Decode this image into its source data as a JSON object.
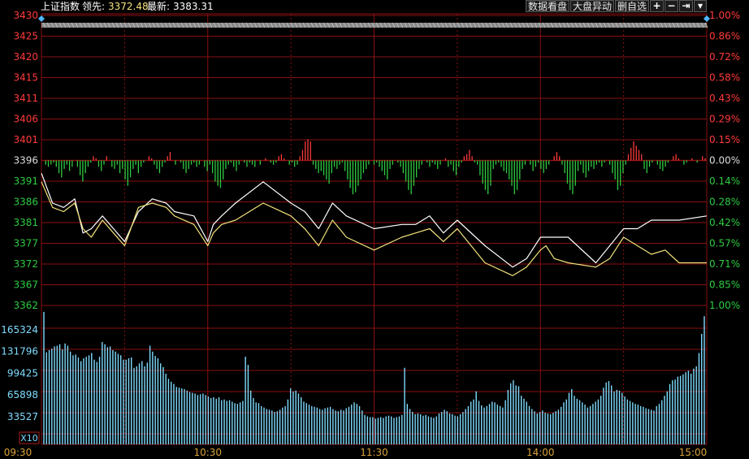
{
  "header": {
    "index_name": "上证指数",
    "leader_label": "领先:",
    "leader_value": "3372.48",
    "latest_label": "最新:",
    "latest_value": "3383.31"
  },
  "toolbar": {
    "data_view_label": "数据看盘",
    "market_move_label": "大盘异动",
    "delete_watchlist_label": "删自选",
    "buttons": [
      {
        "name": "zoom-in-button",
        "icon": "plus-icon",
        "glyph": "+"
      },
      {
        "name": "zoom-out-button",
        "icon": "minus-icon",
        "glyph": "−"
      },
      {
        "name": "pin-right-button",
        "icon": "arrow-bar-right-icon",
        "glyph": "⇥"
      },
      {
        "name": "dropdown-button",
        "icon": "triangle-down-icon",
        "glyph": "▾"
      }
    ]
  },
  "colors": {
    "background": "#000000",
    "grid": "#8a1010",
    "up": "#ff3a3a",
    "down": "#2ecc40",
    "white_line": "#ffffff",
    "yellow_line": "#f2e27a",
    "volume": "#7fdcff",
    "time_labels": "#d8a23a",
    "header_value": "#f2e27a"
  },
  "chart_data": {
    "type": "line",
    "title": "上证指数",
    "prev_close": 3396,
    "price_ticks": [
      "3430",
      "3425",
      "3420",
      "3415",
      "3411",
      "3406",
      "3401",
      "3396",
      "3391",
      "3386",
      "3381",
      "3377",
      "3372",
      "3367",
      "3362"
    ],
    "pct_ticks": [
      "1.00%",
      "0.86%",
      "0.72%",
      "0.58%",
      "0.43%",
      "0.29%",
      "0.15%",
      "0.00%",
      "0.14%",
      "0.28%",
      "0.42%",
      "0.57%",
      "0.71%",
      "0.85%",
      "1.00%"
    ],
    "ylim": [
      3362,
      3430
    ],
    "x_ticks": [
      "09:30",
      "10:30",
      "11:30",
      "14:00",
      "15:00"
    ],
    "x_tick_minutes": [
      0,
      60,
      120,
      180,
      240
    ],
    "series": [
      {
        "name": "最新",
        "color": "#ffffff",
        "x": [
          0,
          4,
          8,
          12,
          15,
          18,
          22,
          26,
          30,
          35,
          40,
          45,
          48,
          55,
          60,
          62,
          65,
          70,
          80,
          90,
          95,
          100,
          105,
          110,
          120,
          130,
          135,
          140,
          145,
          150,
          160,
          170,
          175,
          180,
          182,
          185,
          190,
          200,
          205,
          210,
          215,
          220,
          225,
          230,
          240
        ],
        "y": [
          3393,
          3386,
          3385,
          3387,
          3379,
          3380,
          3383,
          3380,
          3377,
          3384,
          3387,
          3386,
          3384,
          3383,
          3377,
          3381,
          3383,
          3386,
          3391,
          3386,
          3384,
          3380,
          3386,
          3383,
          3380,
          3381,
          3381,
          3383,
          3379,
          3382,
          3376,
          3371,
          3373,
          3378,
          3378,
          3378,
          3378,
          3372,
          3376,
          3380,
          3380,
          3382,
          3382,
          3382,
          3383
        ]
      },
      {
        "name": "领先",
        "color": "#f2e27a",
        "x": [
          0,
          4,
          8,
          12,
          15,
          18,
          22,
          26,
          30,
          35,
          40,
          45,
          48,
          55,
          60,
          62,
          65,
          70,
          80,
          90,
          95,
          100,
          105,
          110,
          120,
          130,
          135,
          140,
          145,
          150,
          160,
          170,
          175,
          180,
          182,
          185,
          190,
          200,
          205,
          210,
          215,
          220,
          225,
          230,
          240
        ],
        "y": [
          3391,
          3385,
          3384,
          3386,
          3380,
          3378,
          3382,
          3379,
          3376,
          3385,
          3386,
          3385,
          3383,
          3381,
          3376,
          3379,
          3381,
          3382,
          3386,
          3383,
          3380,
          3376,
          3382,
          3378,
          3375,
          3378,
          3379,
          3380,
          3377,
          3380,
          3372,
          3369,
          3371,
          3375,
          3376,
          3373,
          3372,
          3371,
          3373,
          3378,
          3376,
          3374,
          3375,
          3372,
          3372
        ]
      }
    ],
    "diff_bars_scale": "0 = 0.00% line, positive = red (up), negative = green (down), units ≈ 0.01%",
    "diff_bars": [
      0,
      -2,
      -3,
      -2,
      -1,
      -3,
      -6,
      -8,
      -4,
      -2,
      -5,
      -3,
      0,
      -3,
      -7,
      -10,
      -6,
      -3,
      -1,
      2,
      1,
      -3,
      -5,
      -2,
      2,
      0,
      -3,
      -4,
      -2,
      -6,
      -4,
      -9,
      -12,
      -8,
      -4,
      -2,
      -6,
      -3,
      -1,
      0,
      2,
      1,
      -2,
      -4,
      -6,
      -3,
      -1,
      2,
      4,
      0,
      -2,
      0,
      -1,
      -4,
      -6,
      -4,
      -2,
      -1,
      -3,
      -2,
      0,
      -3,
      -5,
      -2,
      -6,
      -10,
      -12,
      -13,
      -9,
      -4,
      -2,
      -1,
      -3,
      -5,
      -2,
      0,
      -1,
      -3,
      -1,
      -2,
      -3,
      0,
      -2,
      0,
      1,
      0,
      -1,
      -2,
      -1,
      2,
      3,
      1,
      0,
      -2,
      -1,
      -3,
      -2,
      2,
      5,
      9,
      10,
      9,
      -2,
      -4,
      -6,
      -5,
      -7,
      -9,
      -11,
      -6,
      -3,
      -4,
      -2,
      -1,
      -5,
      -9,
      -13,
      -16,
      -15,
      -12,
      -9,
      -6,
      -4,
      -2,
      0,
      -2,
      -1,
      -3,
      -5,
      -7,
      -9,
      -4,
      -2,
      0,
      -1,
      -3,
      -6,
      -10,
      -14,
      -16,
      -12,
      -8,
      -4,
      -2,
      0,
      -1,
      -3,
      -1,
      -2,
      -4,
      -2,
      0,
      1,
      -3,
      -2,
      -5,
      -7,
      -3,
      -1,
      2,
      3,
      5,
      2,
      -1,
      -2,
      -7,
      -11,
      -14,
      -16,
      -12,
      -4,
      -2,
      -1,
      -3,
      -5,
      -6,
      -9,
      -12,
      -16,
      -14,
      -9,
      -4,
      -2,
      0,
      -2,
      -5,
      -3,
      -1,
      -4,
      -6,
      -4,
      -2,
      0,
      2,
      4,
      2,
      -2,
      -6,
      -11,
      -14,
      -16,
      -12,
      -5,
      -2,
      -6,
      -8,
      -5,
      -3,
      -4,
      -2,
      -1,
      -3,
      -1,
      0,
      -2,
      -6,
      -9,
      -14,
      -12,
      -6,
      -2,
      3,
      6,
      9,
      7,
      5,
      3,
      -4,
      -6,
      -3,
      -1,
      0,
      -2,
      -4,
      -5,
      -3,
      -1,
      0,
      2,
      3,
      1,
      0,
      -2,
      -1,
      0,
      1,
      0,
      -1,
      0,
      2,
      1
    ],
    "volume": {
      "label_scale": "X10",
      "ticks": [
        "165324",
        "131796",
        "99425",
        "65898",
        "33527"
      ],
      "ylim": [
        0,
        182000
      ],
      "values": [
        180000,
        125000,
        128000,
        130000,
        133000,
        134000,
        136000,
        129000,
        137000,
        134000,
        126000,
        121000,
        122000,
        118000,
        113000,
        117000,
        119000,
        121000,
        124000,
        115000,
        112000,
        119000,
        139000,
        136000,
        132000,
        133000,
        128000,
        126000,
        123000,
        121000,
        115000,
        115000,
        117000,
        118000,
        104000,
        106000,
        110000,
        113000,
        106000,
        111000,
        134000,
        126000,
        120000,
        117000,
        110000,
        105000,
        96000,
        89000,
        85000,
        82000,
        78000,
        77000,
        76000,
        75000,
        73000,
        71000,
        70000,
        69000,
        67000,
        68000,
        69000,
        67000,
        65000,
        63000,
        64000,
        62000,
        64000,
        60000,
        61000,
        59000,
        60000,
        58000,
        56000,
        55000,
        57000,
        59000,
        119000,
        108000,
        73000,
        63000,
        57000,
        56000,
        52000,
        50000,
        48000,
        47000,
        46000,
        44000,
        45000,
        47000,
        50000,
        52000,
        61000,
        76000,
        72000,
        73000,
        69000,
        64000,
        58000,
        56000,
        54000,
        52000,
        51000,
        50000,
        48000,
        47000,
        49000,
        50000,
        51000,
        48000,
        46000,
        45000,
        47000,
        46000,
        49000,
        51000,
        54000,
        57000,
        55000,
        52000,
        46000,
        40000,
        38000,
        37000,
        37000,
        35000,
        36000,
        37000,
        36000,
        38000,
        39000,
        38000,
        36000,
        37000,
        38000,
        40000,
        104000,
        55000,
        48000,
        44000,
        41000,
        42000,
        41000,
        39000,
        40000,
        38000,
        37000,
        36000,
        38000,
        42000,
        44000,
        47000,
        45000,
        42000,
        41000,
        39000,
        38000,
        41000,
        44000,
        48000,
        52000,
        58000,
        61000,
        72000,
        59000,
        53000,
        50000,
        52000,
        55000,
        58000,
        57000,
        54000,
        52000,
        50000,
        60000,
        74000,
        83000,
        87000,
        80000,
        79000,
        66000,
        62000,
        58000,
        52000,
        48000,
        45000,
        42000,
        44000,
        46000,
        43000,
        42000,
        41000,
        43000,
        45000,
        47000,
        51000,
        57000,
        61000,
        70000,
        75000,
        66000,
        62000,
        60000,
        57000,
        54000,
        50000,
        52000,
        55000,
        58000,
        61000,
        66000,
        77000,
        84000,
        86000,
        80000,
        72000,
        74000,
        73000,
        70000,
        65000,
        61000,
        59000,
        57000,
        55000,
        54000,
        52000,
        51000,
        49000,
        48000,
        47000,
        46000,
        52000,
        55000,
        60000,
        66000,
        72000,
        82000,
        87000,
        88000,
        92000,
        93000,
        95000,
        98000,
        100000,
        96000,
        103000,
        106000,
        124000,
        150000,
        174000
      ]
    }
  }
}
